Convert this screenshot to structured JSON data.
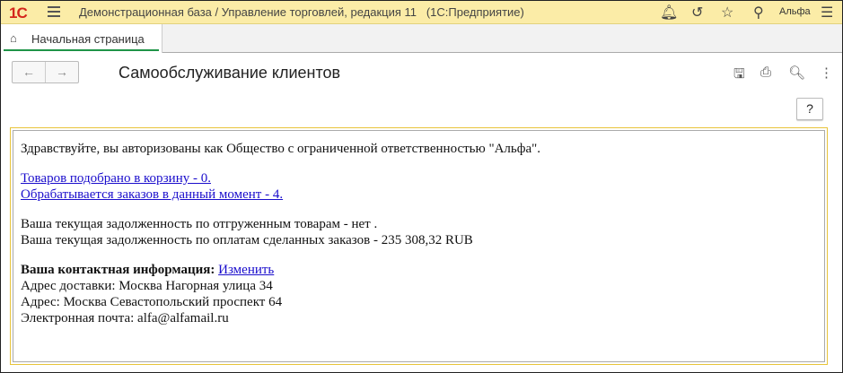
{
  "topbar": {
    "logo": "1С",
    "title": "Демонстрационная база / Управление торговлей, редакция 11   (1С:Предприятие)",
    "user": "Альфа"
  },
  "tabs": [
    {
      "label": "Начальная страница"
    }
  ],
  "page": {
    "title": "Самообслуживание клиентов",
    "help_label": "?"
  },
  "content": {
    "greeting": "Здравствуйте, вы авторизованы как Общество с ограниченной ответственностью \"Альфа\".",
    "cart_link": "Товаров подобрано в корзину - 0.",
    "orders_link": "Обрабатывается заказов в данный момент - 4.",
    "debt_shipped": "Ваша текущая задолженность по отгруженным товарам - нет .",
    "debt_orders": "Ваша текущая задолженность по оплатам сделанных заказов - 235 308,32 RUB",
    "contact_heading": "Ваша контактная информация:",
    "edit_link": "Изменить",
    "delivery_address": "Адрес доставки: Москва Нагорная улица 34",
    "address": "Адрес: Москва Севастопольский проспект 64",
    "email": "Электронная почта: alfa@alfamail.ru"
  }
}
